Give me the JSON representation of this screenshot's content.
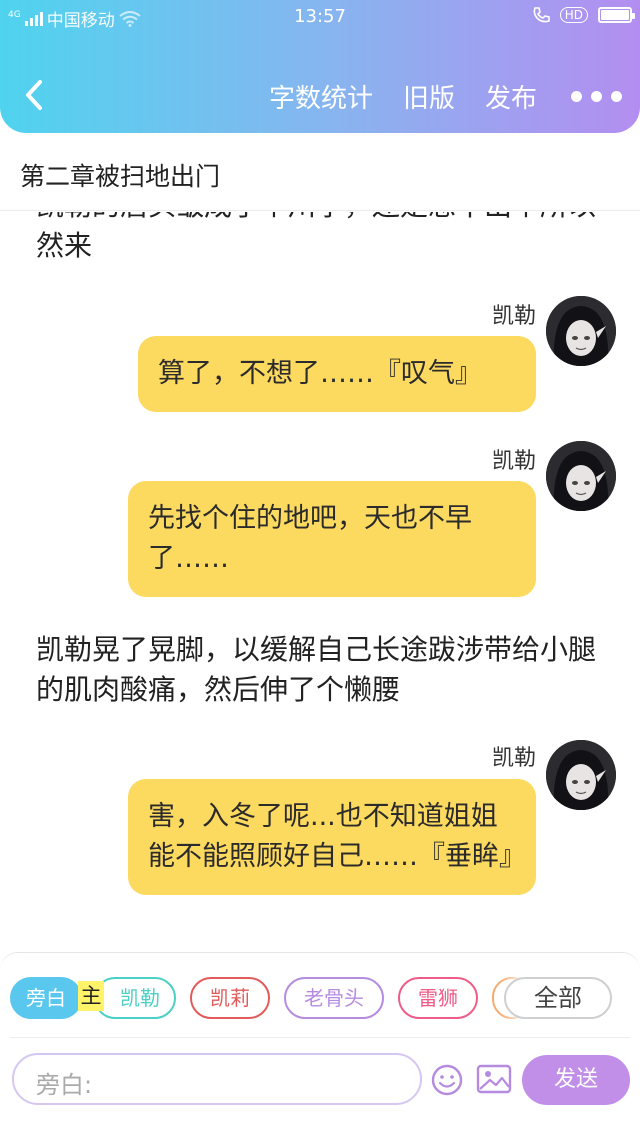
{
  "status_bar": {
    "network_badge": "4G",
    "carrier": "中国移动",
    "time": "13:57",
    "hd_badge": "HD",
    "battery_level": 1.0
  },
  "header": {
    "back_icon": "chevron-left-icon",
    "actions": {
      "word_count": "字数统计",
      "old_version": "旧版",
      "publish": "发布"
    },
    "more_icon": "more-dots-icon",
    "gradient": [
      "#4fd3ef",
      "#b38ef0"
    ]
  },
  "chapter": {
    "title": "第二章被扫地出门"
  },
  "messages": [
    {
      "type": "narration",
      "text": "凯勒的眉头皱成了个川字，还是想不出个所以然来"
    },
    {
      "type": "dialogue",
      "speaker": "凯勒",
      "text": "算了，不想了……『叹气』"
    },
    {
      "type": "dialogue",
      "speaker": "凯勒",
      "text": "先找个住的地吧，天也不早了……"
    },
    {
      "type": "narration",
      "text": "凯勒晃了晃脚，以缓解自己长途跋涉带给小腿的肌肉酸痛，然后伸了个懒腰"
    },
    {
      "type": "dialogue",
      "speaker": "凯勒",
      "text": "害，入冬了呢...也不知道姐姐能不能照顾好自己……『垂眸』"
    }
  ],
  "bubble_color": "#fcd95f",
  "roles": {
    "chips": [
      {
        "label": "旁白",
        "color": "#5ac8ee",
        "selected": true
      },
      {
        "label": "凯勒",
        "color": "#4ccfc4",
        "selected": false
      },
      {
        "label": "凯莉",
        "color": "#e25a5a",
        "selected": false
      },
      {
        "label": "老骨头",
        "color": "#b58be0",
        "selected": false
      },
      {
        "label": "雷狮",
        "color": "#ef5c87",
        "selected": false
      },
      {
        "label": "",
        "color": "#f5a86b",
        "selected": false
      }
    ],
    "main_tag": "主",
    "all_label": "全部"
  },
  "composer": {
    "placeholder": "旁白:",
    "emoji_icon": "smiley-icon",
    "image_icon": "image-icon",
    "send_label": "发送",
    "send_color": "#c18ee8"
  }
}
